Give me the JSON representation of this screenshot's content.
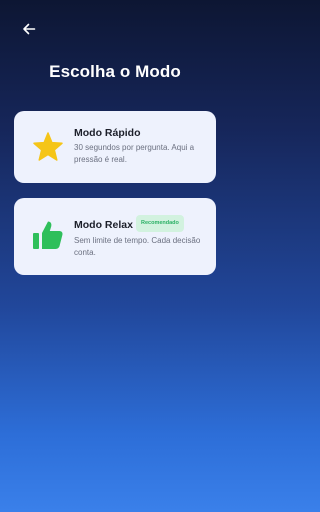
{
  "header": {
    "back_icon": "arrow-left-icon",
    "title": "Escolha o Modo"
  },
  "modes": [
    {
      "icon": "star-icon",
      "icon_color": "#f5c518",
      "title": "Modo Rápido",
      "description": "30 segundos por pergunta. Aqui a pressão é real."
    },
    {
      "icon": "thumbs-up-icon",
      "icon_color": "#2fbf5b",
      "title": "Modo Relax",
      "badge": "Recomendado",
      "description": "Sem limite de tempo. Cada decisão conta."
    }
  ],
  "colors": {
    "card_background": "#eef2fd",
    "badge_background": "#d2f2df",
    "badge_text": "#2bb065",
    "background_top": "#0d1633",
    "background_bottom": "#3a80ea"
  }
}
